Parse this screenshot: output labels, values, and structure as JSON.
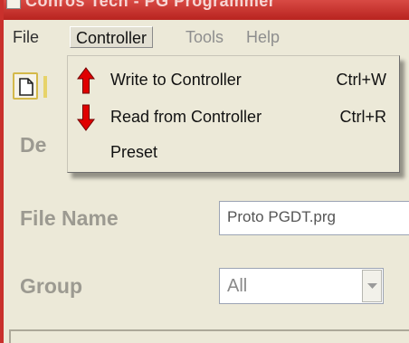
{
  "title_bar": {
    "title": "Conros Tech - PG Programmer"
  },
  "menubar": {
    "items": [
      {
        "label": "File",
        "state": "normal"
      },
      {
        "label": "Controller",
        "state": "active"
      },
      {
        "label": "Tools",
        "state": "disabled"
      },
      {
        "label": "Help",
        "state": "disabled"
      }
    ]
  },
  "controller_menu": {
    "items": [
      {
        "label": "Write to Controller",
        "shortcut": "Ctrl+W",
        "icon": "red-up-arrow-icon"
      },
      {
        "label": "Read from Controller",
        "shortcut": "Ctrl+R",
        "icon": "red-down-arrow-icon"
      },
      {
        "label": "Preset",
        "shortcut": "",
        "icon": ""
      }
    ]
  },
  "form": {
    "description_label_partial": "De",
    "file_name_label": "File Name",
    "file_name_value": "Proto PGDT.prg",
    "group_label": "Group",
    "group_value": "All"
  },
  "colors": {
    "title_bar": "#c9302c",
    "window_bg": "#ece9d8",
    "arrow_red": "#e00000"
  }
}
